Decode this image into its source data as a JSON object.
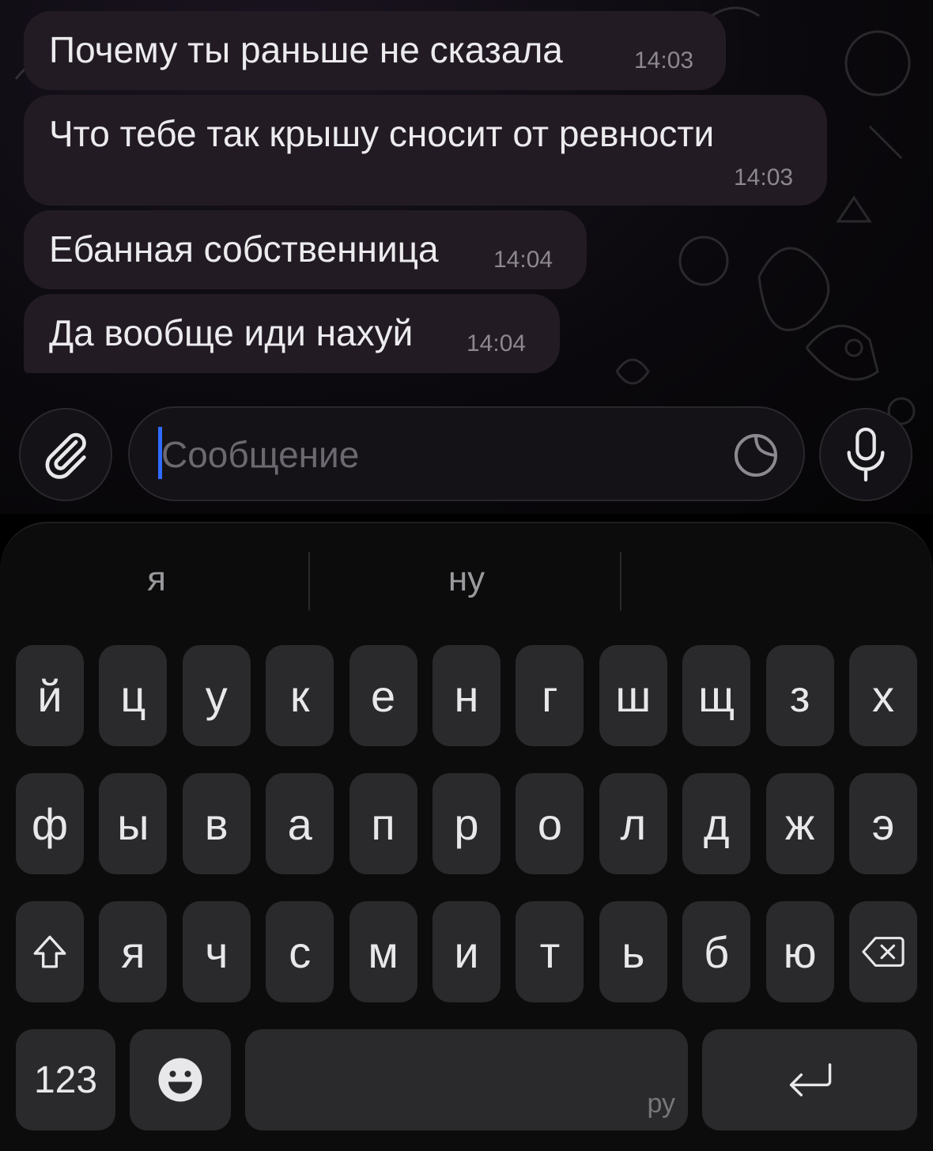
{
  "messages": [
    {
      "text": "Почему ты раньше не сказала",
      "time": "14:03"
    },
    {
      "text": "Что тебе так крышу сносит от ревности",
      "time": "14:03"
    },
    {
      "text": "Ебанная собственница",
      "time": "14:04"
    },
    {
      "text": "Да вообще иди нахуй",
      "time": "14:04"
    }
  ],
  "composer": {
    "placeholder": "Сообщение",
    "attach_icon": "paperclip-icon",
    "sticker_icon": "sticker-icon",
    "mic_icon": "microphone-icon"
  },
  "keyboard": {
    "suggestions": [
      "я",
      "ну",
      ""
    ],
    "row1": [
      "й",
      "ц",
      "у",
      "к",
      "е",
      "н",
      "г",
      "ш",
      "щ",
      "з",
      "х"
    ],
    "row2": [
      "ф",
      "ы",
      "в",
      "а",
      "п",
      "р",
      "о",
      "л",
      "д",
      "ж",
      "э"
    ],
    "row3": [
      "я",
      "ч",
      "с",
      "м",
      "и",
      "т",
      "ь",
      "б",
      "ю"
    ],
    "numbers_label": "123",
    "space_language": "ру",
    "shift_icon": "shift-icon",
    "backspace_icon": "backspace-icon",
    "emoji_icon": "emoji-icon",
    "enter_icon": "return-icon"
  },
  "colors": {
    "accent_cursor": "#2f6bff",
    "bubble": "#221b24",
    "key": "#2a2a2c"
  }
}
